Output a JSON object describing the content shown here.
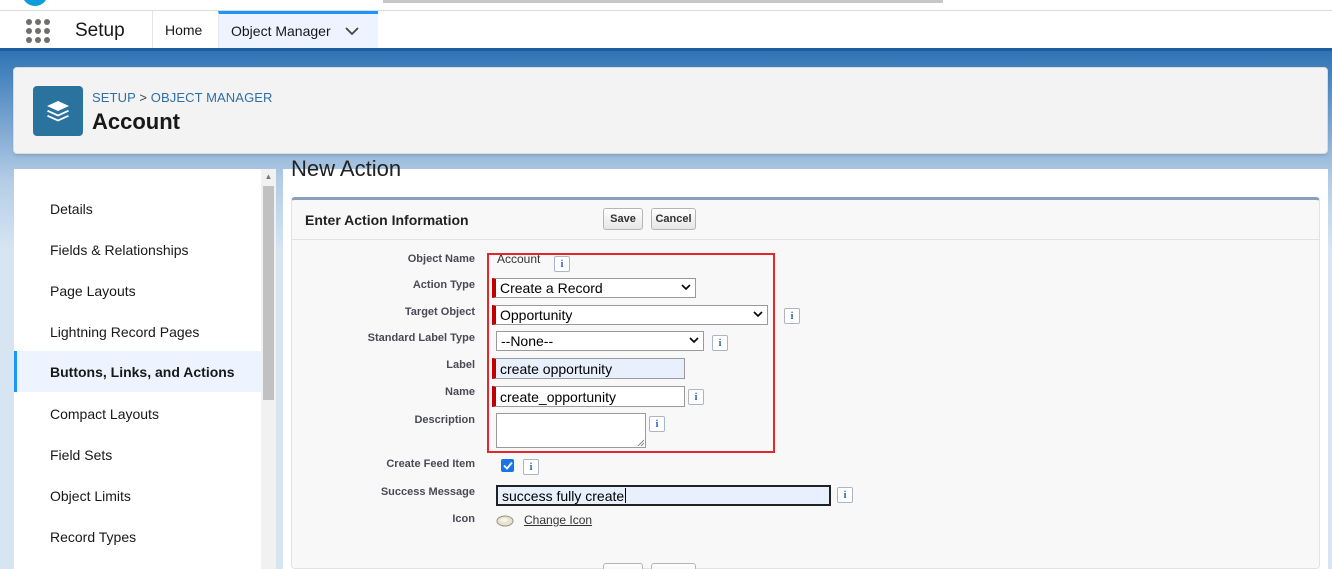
{
  "app": {
    "name": "Setup"
  },
  "nav": {
    "tabs": [
      {
        "label": "Home"
      },
      {
        "label": "Object Manager"
      }
    ]
  },
  "header": {
    "breadcrumb_setup": "SETUP",
    "breadcrumb_separator": ">",
    "breadcrumb_object_manager": "OBJECT MANAGER",
    "title": "Account"
  },
  "sidebar": {
    "items": [
      {
        "label": "Details"
      },
      {
        "label": "Fields & Relationships"
      },
      {
        "label": "Page Layouts"
      },
      {
        "label": "Lightning Record Pages"
      },
      {
        "label": "Buttons, Links, and Actions",
        "active": true
      },
      {
        "label": "Compact Layouts"
      },
      {
        "label": "Field Sets"
      },
      {
        "label": "Object Limits"
      },
      {
        "label": "Record Types"
      }
    ]
  },
  "main": {
    "page_title": "New Action",
    "section_title": "Enter Action Information",
    "save_label": "Save",
    "cancel_label": "Cancel",
    "fields": {
      "object_name": {
        "label": "Object Name",
        "value": "Account"
      },
      "action_type": {
        "label": "Action Type",
        "value": "Create a Record"
      },
      "target_object": {
        "label": "Target Object",
        "value": "Opportunity"
      },
      "standard_label_type": {
        "label": "Standard Label Type",
        "value": "--None--"
      },
      "label": {
        "label": "Label",
        "value": "create opportunity"
      },
      "name": {
        "label": "Name",
        "value": "create_opportunity"
      },
      "description": {
        "label": "Description",
        "value": ""
      },
      "create_feed_item": {
        "label": "Create Feed Item",
        "checked": true
      },
      "success_message": {
        "label": "Success Message",
        "value": "success fully create"
      },
      "icon": {
        "label": "Icon",
        "link": "Change Icon"
      }
    },
    "info_glyph": "i"
  },
  "colors": {
    "brand_blue": "#1b96ff",
    "required_bar": "#c00000",
    "highlight_box": "#e0282e",
    "object_icon": "#2a739e"
  }
}
